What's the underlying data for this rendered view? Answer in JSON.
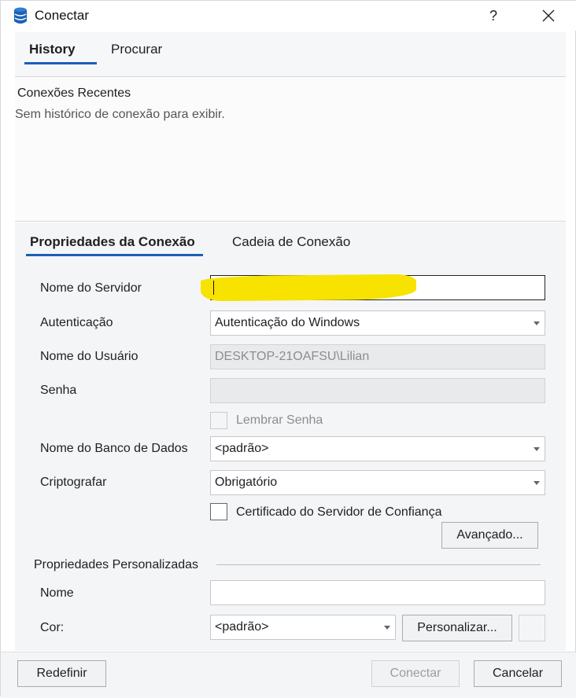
{
  "window": {
    "title": "Conectar",
    "help": "?",
    "close": "✕"
  },
  "top_tabs": [
    {
      "label": "History",
      "active": true
    },
    {
      "label": "Procurar",
      "active": false
    }
  ],
  "history": {
    "title": "Conexões Recentes",
    "empty_message": "Sem histórico de conexão para exibir."
  },
  "props_tabs": [
    {
      "label": "Propriedades da Conexão",
      "active": true
    },
    {
      "label": "Cadeia de Conexão",
      "active": false
    }
  ],
  "form": {
    "server_name": {
      "label": "Nome do Servidor",
      "value": ""
    },
    "authentication": {
      "label": "Autenticação",
      "value": "Autenticação do Windows"
    },
    "username": {
      "label": "Nome do Usuário",
      "value": "DESKTOP-21OAFSU\\Lilian"
    },
    "password": {
      "label": "Senha",
      "value": ""
    },
    "remember_password": {
      "label": "Lembrar Senha",
      "checked": false,
      "enabled": false
    },
    "database": {
      "label": "Nome do Banco de Dados",
      "value": "<padrão>"
    },
    "encrypt": {
      "label": "Criptografar",
      "value": "Obrigatório"
    },
    "trust_cert": {
      "label": "Certificado do Servidor de Confiança",
      "checked": false
    },
    "advanced_button": "Avançado..."
  },
  "custom": {
    "group_title": "Propriedades Personalizadas",
    "name": {
      "label": "Nome",
      "value": ""
    },
    "color": {
      "label": "Cor:",
      "value": "<padrão>"
    },
    "customize_button": "Personalizar..."
  },
  "footer": {
    "reset": "Redefinir",
    "connect": "Conectar",
    "cancel": "Cancelar"
  },
  "colors": {
    "accent": "#1b5eb8",
    "highlight": "#f7e200"
  }
}
